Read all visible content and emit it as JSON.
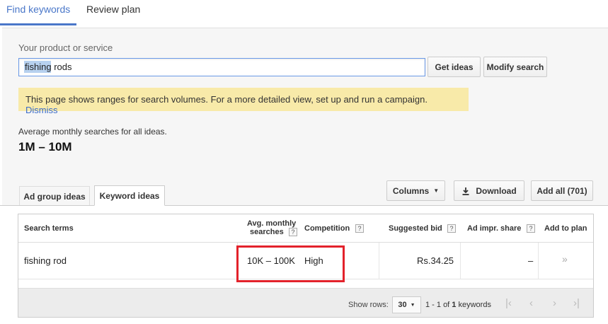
{
  "top_tabs": {
    "find": "Find keywords",
    "review": "Review plan"
  },
  "search": {
    "label": "Your product or service",
    "value": "fishing rods",
    "placeholder": ""
  },
  "buttons": {
    "get_ideas": "Get ideas",
    "modify_search": "Modify search",
    "columns": "Columns",
    "download": "Download",
    "add_all": "Add all (701)"
  },
  "notice": {
    "text": "This page shows ranges for search volumes. For a more detailed view, set up and run a campaign.",
    "dismiss": "Dismiss"
  },
  "summary": {
    "label": "Average monthly searches for all ideas.",
    "value": "1M – 10M"
  },
  "tabs": {
    "ad_group": "Ad group ideas",
    "keyword": "Keyword ideas"
  },
  "table": {
    "headers": {
      "term": "Search terms",
      "avg_line1": "Avg. monthly",
      "avg_line2": "searches",
      "competition": "Competition",
      "bid": "Suggested bid",
      "impr": "Ad impr. share",
      "add": "Add to plan"
    },
    "row": {
      "term": "fishing rod",
      "avg": "10K – 100K",
      "competition": "High",
      "bid": "Rs.34.25",
      "impr": "–",
      "add": "»"
    }
  },
  "footer": {
    "show_rows": "Show rows:",
    "rows_value": "30",
    "range_prefix": "1 - 1 of ",
    "range_count": "1",
    "range_suffix": " keywords"
  },
  "colors": {
    "accent": "#4a77c9",
    "highlight": "#e3222b",
    "notice_bg": "#f8eaa9"
  }
}
